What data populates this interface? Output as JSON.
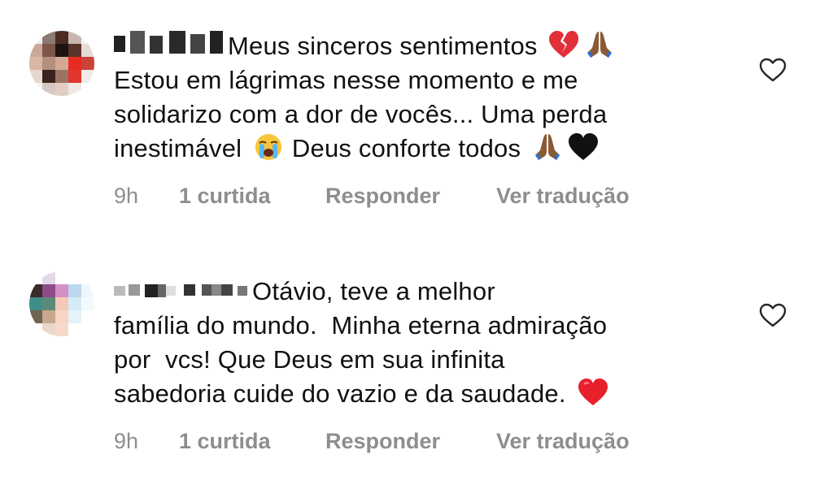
{
  "comments": [
    {
      "text": "Meus sinceros sentimentos",
      "text_line2": "Estou em lágrimas nesse momento e me",
      "text_line3": "solidarizo com a dor de vocês... Uma perda",
      "text_line4": "inestimável",
      "text_line4b": "Deus conforte todos",
      "emojis": [
        "broken-heart",
        "praying-hands",
        "loudly-crying-face",
        "praying-hands",
        "black-heart"
      ],
      "time": "9h",
      "likes": "1 curtida",
      "reply_label": "Responder",
      "translate_label": "Ver tradução"
    },
    {
      "text_line1": "Otávio, teve a melhor",
      "text_line2": "família do mundo.  Minha eterna admiração",
      "text_line3": "por  vcs! Que Deus em sua infinita",
      "text_line4": "sabedoria cuide do vazio e da saudade.",
      "emojis": [
        "red-heart"
      ],
      "time": "9h",
      "likes": "1 curtida",
      "reply_label": "Responder",
      "translate_label": "Ver tradução"
    }
  ],
  "colors": {
    "meta_gray": "#8e8e8e",
    "text": "#111111",
    "heart_outline": "#262626"
  }
}
